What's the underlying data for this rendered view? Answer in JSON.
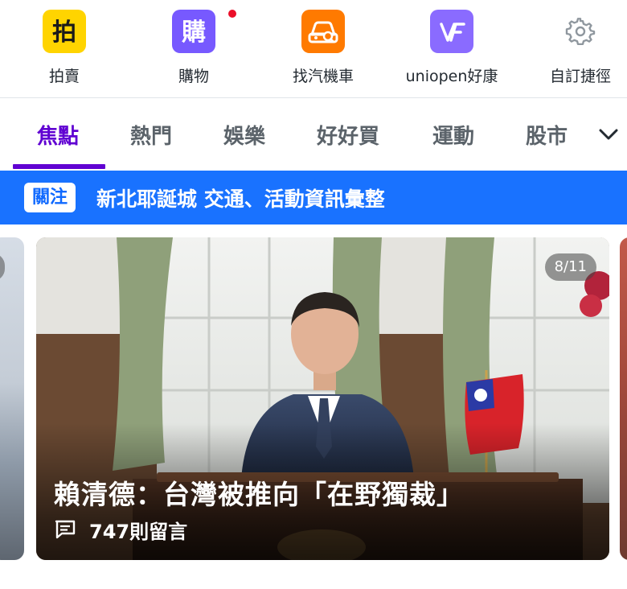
{
  "shortcuts": [
    {
      "label": "拍賣",
      "icon": "auction-icon",
      "color": "#ffd400",
      "glyph": "拍"
    },
    {
      "label": "購物",
      "icon": "shopping-icon",
      "color": "#7759ff",
      "glyph": "購"
    },
    {
      "label": "找汽機車",
      "icon": "car-icon",
      "color": "#ff7a00"
    },
    {
      "label": "uniopen好康",
      "icon": "uniopen-icon",
      "color": "#8a6bff"
    },
    {
      "label": "自訂捷徑",
      "icon": "gear-icon"
    }
  ],
  "tabs": [
    {
      "label": "焦點",
      "active": true
    },
    {
      "label": "熱門",
      "active": false
    },
    {
      "label": "娛樂",
      "active": false
    },
    {
      "label": "好好買",
      "active": false
    },
    {
      "label": "運動",
      "active": false
    },
    {
      "label": "股市",
      "active": false
    }
  ],
  "banner": {
    "badge": "關注",
    "text": "新北耶誕城 交通、活動資訊彙整"
  },
  "carousel": {
    "counter": "8/11",
    "headline": "賴清德：台灣被推向「在野獨裁」",
    "comments": "747則留言"
  },
  "colors": {
    "accent": "#6001d2",
    "banner": "#1972ff",
    "notification_dot": "#eb0f29"
  }
}
